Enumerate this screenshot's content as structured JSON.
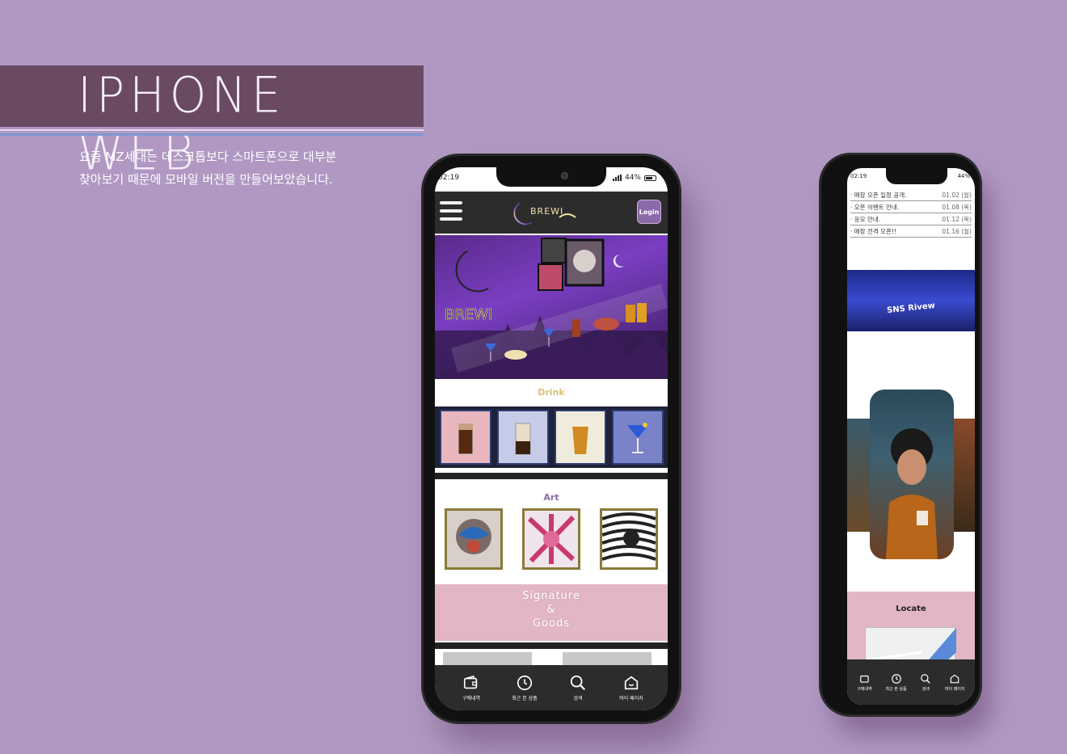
{
  "banner": {
    "title": "IPHONE WEB",
    "description_line1": "요즘 MZ세대는 데스크톱보다 스마트폰으로 대부분",
    "description_line2": "찾아보기 때문에 모바일 버전을 만들어보았습니다."
  },
  "phone1": {
    "status": {
      "time": "02:19",
      "battery": "44%"
    },
    "header": {
      "logo_text": "BREWI",
      "login_label": "Login"
    },
    "drink": {
      "title": "Drink",
      "tiles": [
        "iced-coffee-icon",
        "bubble-tea-icon",
        "beer-icon",
        "blue-cocktail-icon"
      ]
    },
    "art": {
      "title": "Art",
      "tiles": [
        "art-portrait-1",
        "art-abstract-2",
        "art-stripes-3"
      ]
    },
    "signature": {
      "line1": "Signature",
      "line2": "&",
      "line3": "Goods"
    },
    "tabs": [
      {
        "icon": "wallet-icon",
        "label": "구매내역"
      },
      {
        "icon": "clock-icon",
        "label": "최근 본 상품"
      },
      {
        "icon": "search-icon",
        "label": "검색"
      },
      {
        "icon": "home-icon",
        "label": "마이 페이지"
      }
    ]
  },
  "phone2": {
    "status": {
      "time": "02:19",
      "battery": "44%"
    },
    "news": [
      {
        "title": "· 매장 오픈 일정 공개.",
        "date": "01.02 (월)"
      },
      {
        "title": "· 오픈 이벤트 안내.",
        "date": "01.08 (목)"
      },
      {
        "title": "· 응모 안내.",
        "date": "01.12 (목)"
      },
      {
        "title": "· 매장 전격 오픈!!",
        "date": "01.16 (월)"
      }
    ],
    "sns_title": "SNS Rivew",
    "locate_title": "Locate",
    "tabs": [
      {
        "icon": "wallet-icon",
        "label": "구매내역"
      },
      {
        "icon": "clock-icon",
        "label": "최근 본 상품"
      },
      {
        "icon": "search-icon",
        "label": "검색"
      },
      {
        "icon": "home-icon",
        "label": "마이 페이지"
      }
    ]
  },
  "colors": {
    "background": "#b098c2",
    "banner": "#6a4a62",
    "accent_purple": "#8a6aa8",
    "pink": "#e3b6c3",
    "drink_title": "#d6c37a",
    "art_title": "#8a6aa8"
  }
}
